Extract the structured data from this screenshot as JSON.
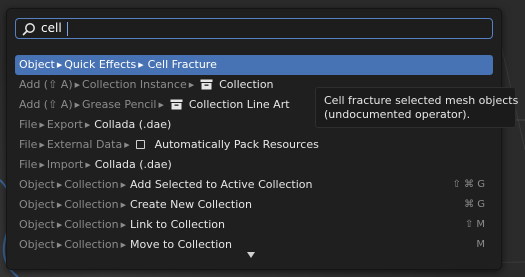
{
  "search": {
    "value": "cell"
  },
  "results": [
    {
      "crumbs": [
        "Object",
        "Quick Effects"
      ],
      "item": "Cell Fracture",
      "icon": "",
      "shortcut": "",
      "selected": true
    },
    {
      "crumbs": [
        "Add (⇧ A)",
        "Collection Instance"
      ],
      "item": "Collection",
      "icon": "collection-icon",
      "shortcut": ""
    },
    {
      "crumbs": [
        "Add (⇧ A)",
        "Grease Pencil"
      ],
      "item": "Collection Line Art",
      "icon": "collection-icon",
      "shortcut": ""
    },
    {
      "crumbs": [
        "File",
        "Export"
      ],
      "item": "Collada (.dae)",
      "icon": "",
      "shortcut": ""
    },
    {
      "crumbs": [
        "File",
        "External Data"
      ],
      "item": "Automatically Pack Resources",
      "icon": "checkbox-icon",
      "shortcut": ""
    },
    {
      "crumbs": [
        "File",
        "Import"
      ],
      "item": "Collada (.dae)",
      "icon": "",
      "shortcut": ""
    },
    {
      "crumbs": [
        "Object",
        "Collection"
      ],
      "item": "Add Selected to Active Collection",
      "icon": "",
      "shortcut": "⇧ ⌘ G"
    },
    {
      "crumbs": [
        "Object",
        "Collection"
      ],
      "item": "Create New Collection",
      "icon": "",
      "shortcut": "⌘ G"
    },
    {
      "crumbs": [
        "Object",
        "Collection"
      ],
      "item": "Link to Collection",
      "icon": "",
      "shortcut": "⇧ M"
    },
    {
      "crumbs": [
        "Object",
        "Collection"
      ],
      "item": "Move to Collection",
      "icon": "",
      "shortcut": "M"
    }
  ],
  "tooltip": {
    "line1": "Cell fracture selected mesh objects",
    "line2": "(undocumented operator)."
  },
  "colors": {
    "accent": "#4772b3",
    "field_border": "#5680c2",
    "popup_bg": "#1f1f1f"
  },
  "icons": {
    "search": "search-icon",
    "more": "down-arrow-icon"
  }
}
